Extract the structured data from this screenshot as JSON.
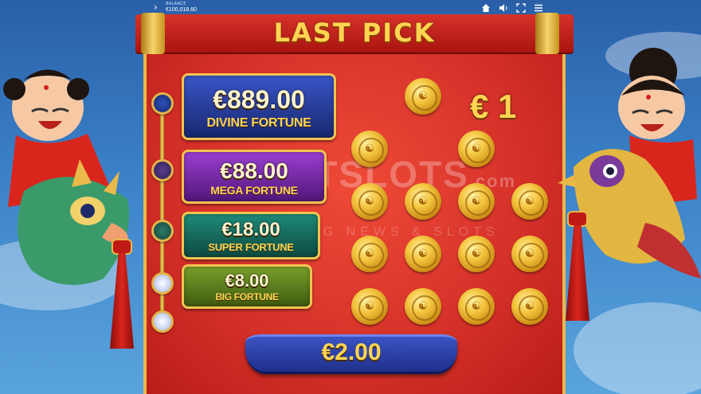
{
  "hud": {
    "balance_label": "BALANCE",
    "balance": "€100,018.60",
    "icons": [
      "home-icon",
      "sound-icon",
      "fullscreen-icon",
      "menu-icon"
    ]
  },
  "title": "LAST PICK",
  "jackpots": [
    {
      "amount": "€889.00",
      "name": "DIVINE FORTUNE"
    },
    {
      "amount": "€88.00",
      "name": "MEGA FORTUNE"
    },
    {
      "amount": "€18.00",
      "name": "SUPER FORTUNE"
    },
    {
      "amount": "€8.00",
      "name": "BIG FORTUNE"
    }
  ],
  "win_prize": "€ 1",
  "bet_amount": "€2.00",
  "watermark": {
    "main": "ABOUTSLOTS",
    "suffix": ".com",
    "sub": "GAMING NEWS & SLOTS"
  },
  "colors": {
    "gold": "#ffd452",
    "red": "#d6322a",
    "sky": "#3b82c8",
    "banner": "#2a3fa8"
  }
}
